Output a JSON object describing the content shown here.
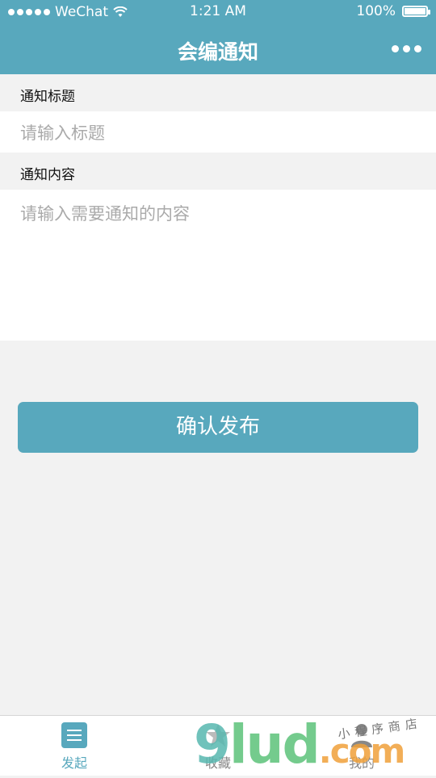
{
  "status_bar": {
    "carrier": "WeChat",
    "time": "1:21 AM",
    "battery": "100%",
    "battery_level": 1.0
  },
  "nav": {
    "title": "会编通知"
  },
  "form": {
    "title_label": "通知标题",
    "title_placeholder": "请输入标题",
    "content_label": "通知内容",
    "content_placeholder": "请输入需要通知的内容"
  },
  "confirm_button": "确认发布",
  "tabbar": {
    "items": [
      {
        "label": "发起",
        "icon": "list-icon",
        "active": true
      },
      {
        "label": "收藏",
        "icon": "star-icon",
        "active": false
      },
      {
        "label": "我的",
        "icon": "user-icon",
        "active": false
      }
    ]
  },
  "watermark": {
    "logo": "9lud.com",
    "tagline": "小程序商店"
  },
  "colors": {
    "primary": "#58a8bd",
    "background": "#f2f2f2"
  }
}
